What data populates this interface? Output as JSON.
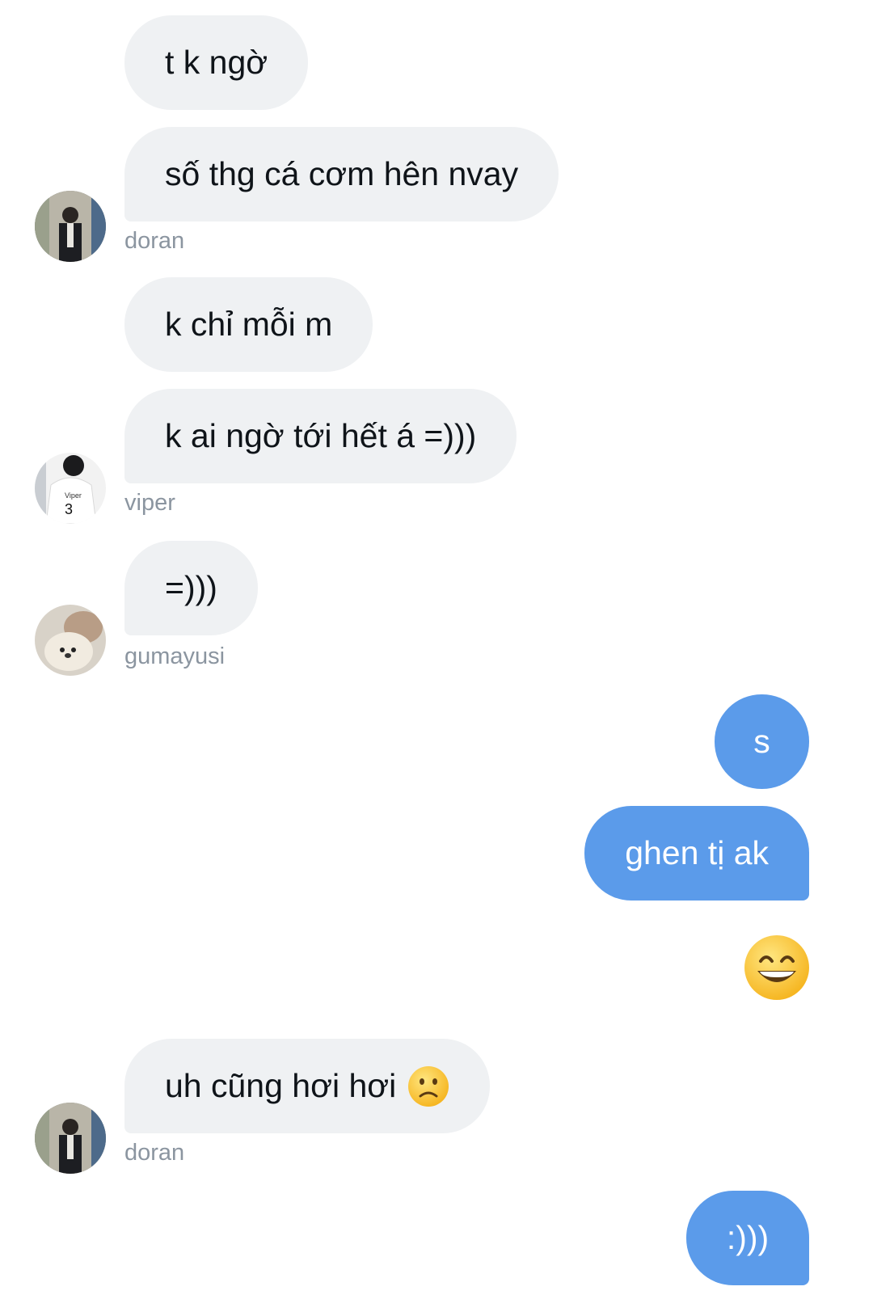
{
  "messages": {
    "m1": "t k ngờ",
    "m2": "số thg cá cơm hên nvay",
    "m3": "k chỉ mỗi m",
    "m4": "k ai ngờ tới hết á =)))",
    "m5": "=)))",
    "m6": "s",
    "m7": "ghen tị ak",
    "m9": "uh cũng hơi hơi",
    "m10": ":)))"
  },
  "senders": {
    "doran_1": "doran",
    "viper": "viper",
    "gumayusi": "gumayusi",
    "doran_2": "doran"
  },
  "emojis": {
    "grin": "grinning-face-emoji",
    "confused": "slightly-frowning-face-emoji"
  },
  "colors": {
    "incoming_bubble": "#eff1f3",
    "outgoing_bubble": "#5b9bea",
    "sender_name": "#8b95a0"
  }
}
